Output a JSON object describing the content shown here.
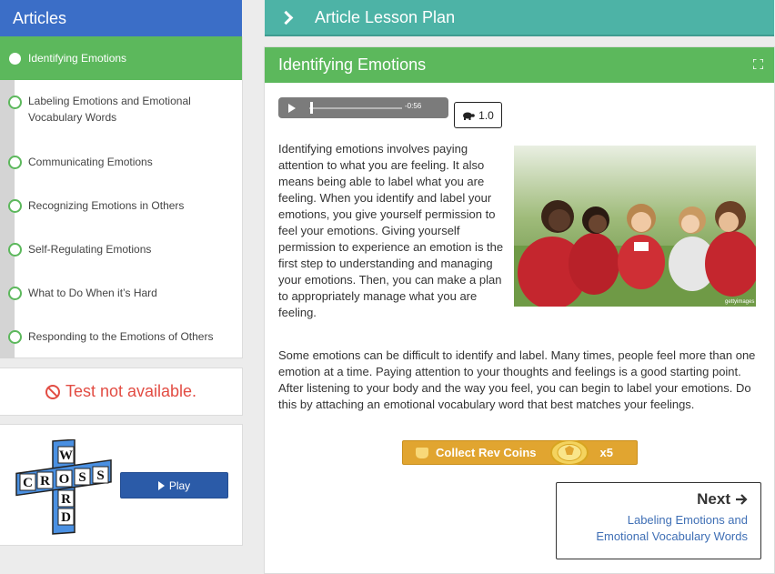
{
  "sidebar": {
    "header": "Articles",
    "items": [
      {
        "label": "Identifying Emotions",
        "active": true
      },
      {
        "label": "Labeling Emotions and Emotional Vocabulary Words"
      },
      {
        "label": "Communicating Emotions"
      },
      {
        "label": "Recognizing Emotions in Others"
      },
      {
        "label": "Self-Regulating Emotions"
      },
      {
        "label": "What to Do When it’s Hard"
      },
      {
        "label": "Responding to the Emotions of Others"
      }
    ],
    "test_status": "Test not available.",
    "game": {
      "logo_letters": "CROSSWORD",
      "play_label": "Play"
    }
  },
  "plan_bar": {
    "title": "Article Lesson Plan"
  },
  "article": {
    "title": "Identifying Emotions",
    "audio": {
      "time": "-0:56",
      "progress": 0.02
    },
    "speed": "1.0",
    "paragraph1": "Identifying emotions involves paying attention to what you are feeling. It also means being able to label what you are feeling. When you identify and label your emotions, you give yourself permission to feel your emotions. Giving yourself permission to experience an emotion is the first step to understanding and managing your emotions. Then, you can make a plan to appropriately manage what you are feeling.",
    "paragraph2": "Some emotions can be difficult to identify and label. Many times, people feel more than one emotion at a time. Paying attention to your thoughts and feelings is a good starting point. After listening to your body and the way you feel, you can begin to label your emotions. Do this by attaching an emotional vocabulary word that best matches your feelings.",
    "image_credit": "gettyimages",
    "coins": {
      "label": "Collect Rev Coins",
      "multiplier": "x5"
    },
    "next": {
      "title": "Next",
      "link": "Labeling Emotions and Emotional Vocabulary Words"
    }
  },
  "colors": {
    "articles_header": "#3b6ec7",
    "active_green": "#5cb85c",
    "teal": "#4db3a6",
    "error_red": "#e24c43",
    "play_blue": "#2b5ba8",
    "coin_orange": "#e1a530",
    "link_blue": "#3f6fb5"
  },
  "icons": [
    "chevron-right-icon",
    "expand-icon",
    "play-icon",
    "turtle-icon",
    "ban-icon",
    "coin-bag-icon",
    "coin-icon",
    "arrow-right-icon"
  ]
}
